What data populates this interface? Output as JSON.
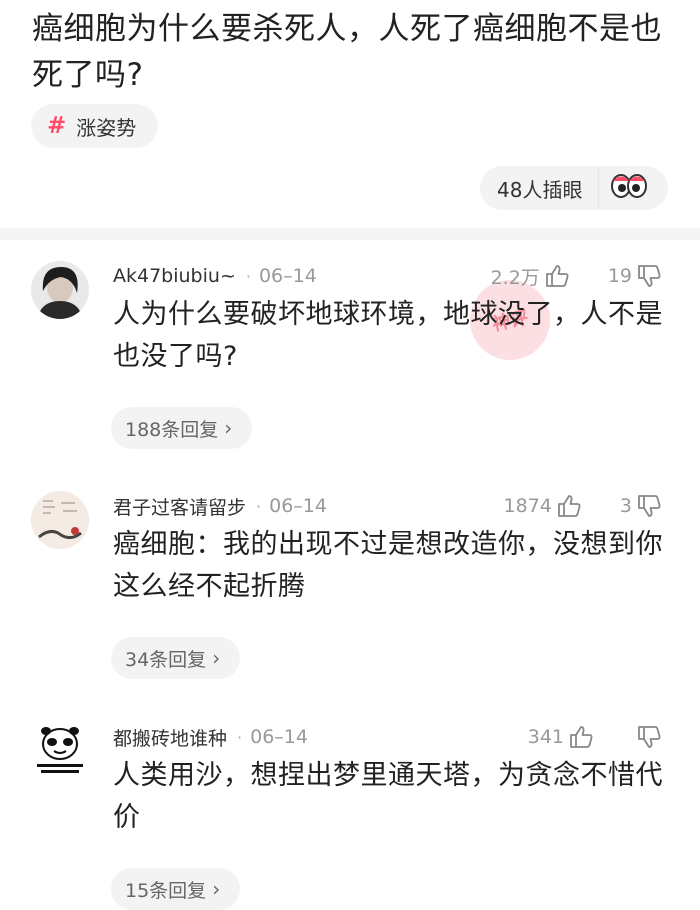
{
  "post": {
    "title": "癌细胞为什么要杀死人，人死了癌细胞不是也死了吗?",
    "tag_icon": "#",
    "tag": "涨姿势",
    "peek_text": "48人插眼"
  },
  "comments": [
    {
      "username": "Ak47biubiu~",
      "dot": "·",
      "date": "06–14",
      "likes": "2.2万",
      "dislikes": "19",
      "text": "人为什么要破坏地球环境，地球没了，人不是也没了吗?",
      "replies": "188条回复"
    },
    {
      "username": "君子过客请留步",
      "dot": "·",
      "date": "06–14",
      "likes": "1874",
      "dislikes": "3",
      "text": "癌细胞：我的出现不过是想改造你，没想到你这么经不起折腾",
      "replies": "34条回复"
    },
    {
      "username": "都搬砖地谁种",
      "dot": "·",
      "date": "06–14",
      "likes": "341",
      "dislikes": "",
      "text": "人类用沙，想捏出梦里通天塔，为贪念不惜代价",
      "replies": "15条回复"
    }
  ],
  "icons": {
    "chevron": "›",
    "like": "thumbs-up-icon",
    "dislike": "thumbs-down-icon",
    "peek": "eyes-icon"
  },
  "colors": {
    "accent": "#ff4d6a",
    "muted": "#999999",
    "chip_bg": "#f3f3f3"
  }
}
